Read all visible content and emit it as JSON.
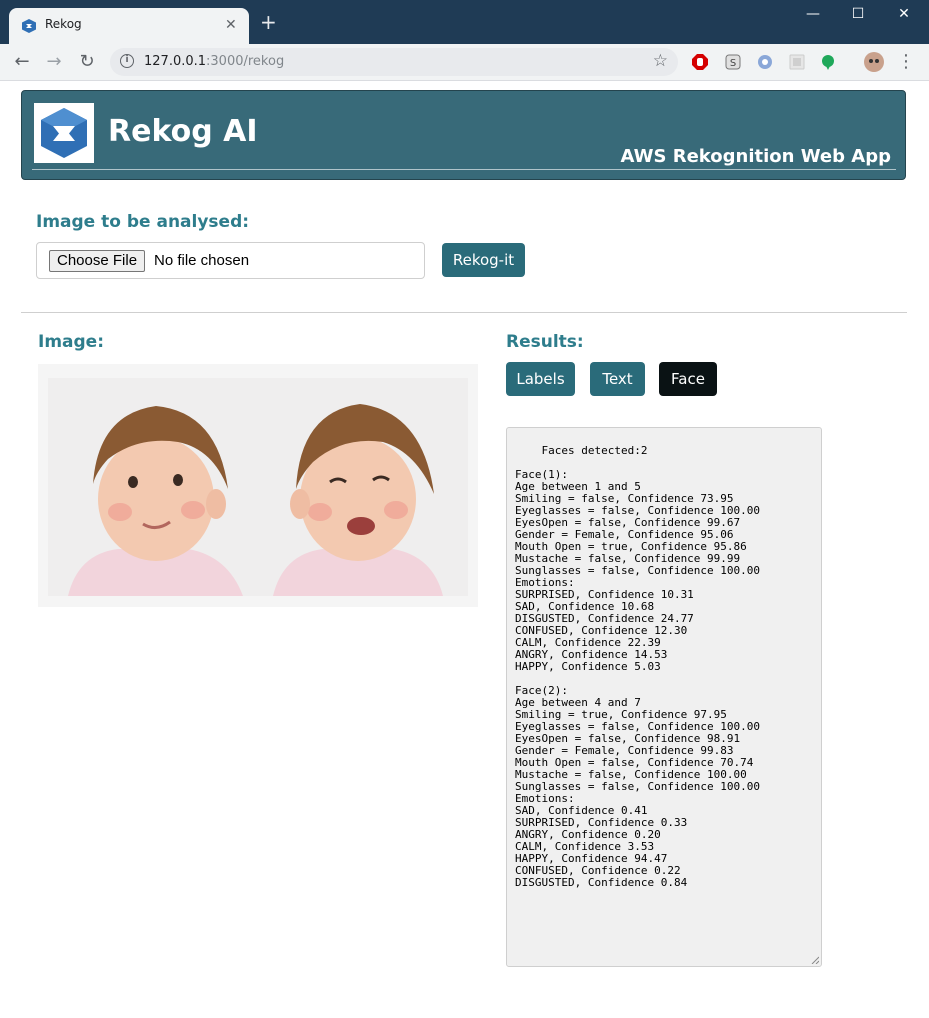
{
  "browser": {
    "tab_title": "Rekog",
    "tab_close": "✕",
    "new_tab": "+",
    "url_host": "127.0.0.1",
    "url_path": ":3000/rekog",
    "minimize": "—",
    "maximize": "☐",
    "close": "✕"
  },
  "header": {
    "title": "Rekog AI",
    "subtitle": "AWS Rekognition Web App"
  },
  "upload": {
    "label": "Image to be analysed:",
    "choose_file": "Choose File",
    "file_status": "No file chosen",
    "submit": "Rekog-it"
  },
  "image_section": {
    "label": "Image:"
  },
  "results": {
    "label": "Results:",
    "tabs": [
      {
        "label": "Labels",
        "active": false
      },
      {
        "label": "Text",
        "active": false
      },
      {
        "label": "Face",
        "active": true
      }
    ],
    "output": "Faces detected:2\n\nFace(1):\nAge between 1 and 5\nSmiling = false, Confidence 73.95\nEyeglasses = false, Confidence 100.00\nEyesOpen = false, Confidence 99.67\nGender = Female, Confidence 95.06\nMouth Open = true, Confidence 95.86\nMustache = false, Confidence 99.99\nSunglasses = false, Confidence 100.00\nEmotions:\nSURPRISED, Confidence 10.31\nSAD, Confidence 10.68\nDISGUSTED, Confidence 24.77\nCONFUSED, Confidence 12.30\nCALM, Confidence 22.39\nANGRY, Confidence 14.53\nHAPPY, Confidence 5.03\n\nFace(2):\nAge between 4 and 7\nSmiling = true, Confidence 97.95\nEyeglasses = false, Confidence 100.00\nEyesOpen = false, Confidence 98.91\nGender = Female, Confidence 99.83\nMouth Open = false, Confidence 70.74\nMustache = false, Confidence 100.00\nSunglasses = false, Confidence 100.00\nEmotions:\nSAD, Confidence 0.41\nSURPRISED, Confidence 0.33\nANGRY, Confidence 0.20\nCALM, Confidence 3.53\nHAPPY, Confidence 94.47\nCONFUSED, Confidence 0.22\nDISGUSTED, Confidence 0.84"
  },
  "colors": {
    "header_bg": "#386a79",
    "accent_text": "#2e7d8c",
    "button_bg": "#2a6b7a",
    "button_active_bg": "#0a1214"
  }
}
